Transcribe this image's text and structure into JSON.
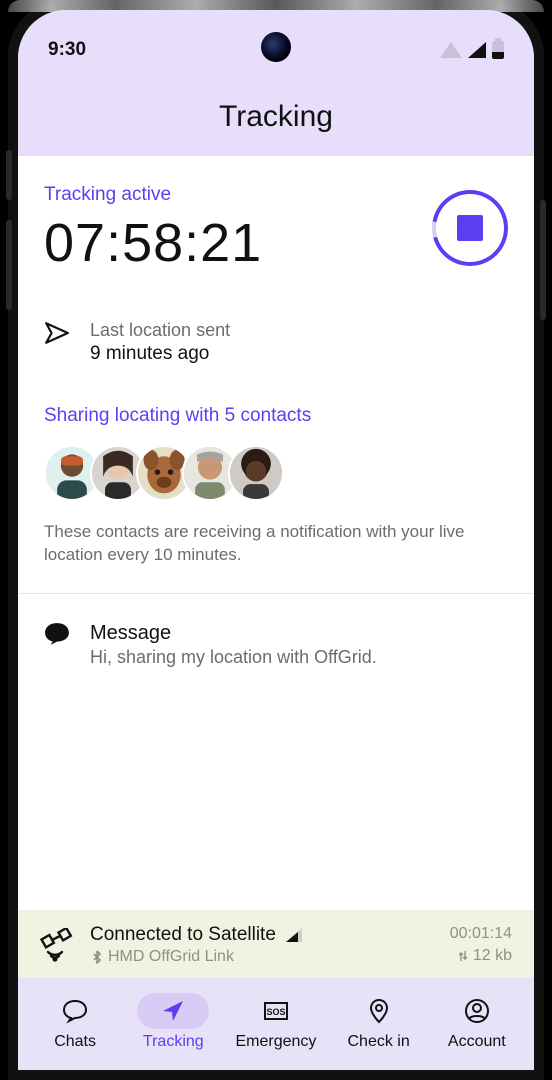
{
  "status_bar": {
    "time": "9:30"
  },
  "header": {
    "title": "Tracking"
  },
  "tracking": {
    "status_label": "Tracking active",
    "elapsed": "07:58:21",
    "last_sent_label": "Last location sent",
    "last_sent_time": "9 minutes ago"
  },
  "sharing": {
    "label": "Sharing locating with 5 contacts",
    "description": "These contacts are receiving a notification with your live location every 10 minutes.",
    "contacts": [
      {
        "name": "contact-1"
      },
      {
        "name": "contact-2"
      },
      {
        "name": "contact-3"
      },
      {
        "name": "contact-4"
      },
      {
        "name": "contact-5"
      }
    ]
  },
  "message": {
    "title": "Message",
    "body": "Hi, sharing my location with OffGrid."
  },
  "sat": {
    "status": "Connected to Satellite",
    "device": "HMD OffGrid Link",
    "timer": "00:01:14",
    "data": "12 kb"
  },
  "nav": {
    "chats": "Chats",
    "tracking": "Tracking",
    "emergency": "Emergency",
    "checkin": "Check in",
    "account": "Account"
  }
}
